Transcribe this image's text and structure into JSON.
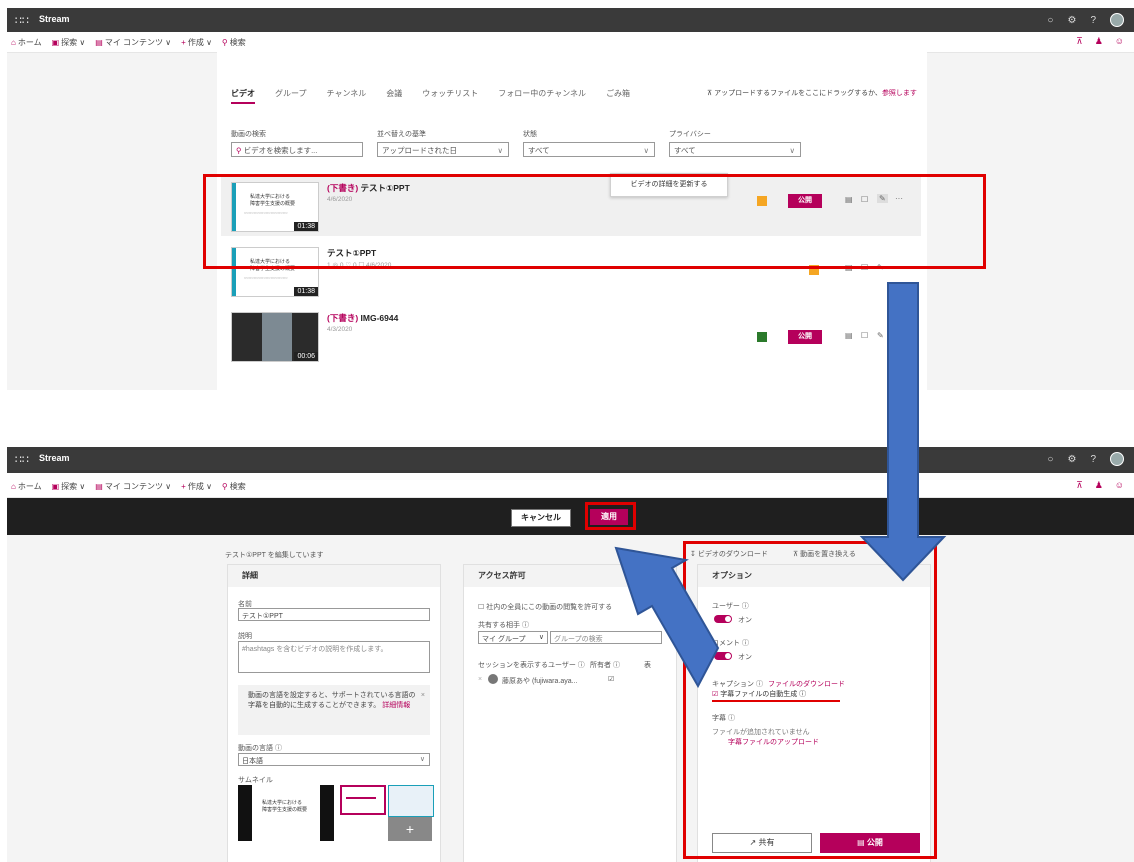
{
  "colors": {
    "brand": "#b5005b",
    "highlight": "#e00000",
    "arrow": "#4472c4",
    "topbar": "#3a3a3a"
  },
  "app": {
    "name": "Stream"
  },
  "nav": {
    "home": "ホーム",
    "browse": "探索",
    "browse_chev": "∨",
    "my_content": "マイ コンテンツ",
    "my_content_chev": "∨",
    "create": "作成",
    "create_chev": "∨",
    "search": "検索"
  },
  "screen1": {
    "tabs": [
      "ビデオ",
      "グループ",
      "チャンネル",
      "会議",
      "ウォッチリスト",
      "フォロー中のチャンネル",
      "ごみ箱"
    ],
    "upload_hint": "アップロードするファイルをここにドラッグするか、",
    "upload_link": "参照します",
    "filters": {
      "search_label": "動画の検索",
      "search_placeholder": "ビデオを検索します...",
      "sort_label": "並べ替えの基準",
      "sort_value": "アップロードされた日",
      "status_label": "状態",
      "status_value": "すべて",
      "privacy_label": "プライバシー",
      "privacy_value": "すべて",
      "chev": "∨"
    },
    "videos": [
      {
        "draft": "(下書き)",
        "title": "テスト①PPT",
        "meta": "4/6/2020",
        "duration": "01:38",
        "publish": "公開",
        "more": "···",
        "thumb_title": "私達大学における\n障害学生支援の概要",
        "thumb_sub": "○○○○○○○○○○○○○○○○○○"
      },
      {
        "draft": "",
        "title": "テスト①PPT",
        "meta": "1 ◎   0 ♡   0 ☐   4/6/2020",
        "duration": "01:38",
        "thumb_title": "私達大学における\n障害学生支援の概要",
        "thumb_sub": "○○○○○○○○○○○○○○○○○○"
      },
      {
        "draft": "(下書き)",
        "title": "IMG-6944",
        "meta": "4/3/2020",
        "duration": "00:06",
        "publish": "公開"
      }
    ],
    "tooltip": "ビデオの詳細を更新する"
  },
  "screen2": {
    "cancel": "キャンセル",
    "apply": "適用",
    "editing_label": "テスト①PPT を編集しています",
    "details": {
      "header": "詳細",
      "name_label": "名前",
      "name_value": "テスト①PPT",
      "desc_label": "説明",
      "desc_placeholder": "#hashtags を含むビデオの説明を作成します。",
      "notice": "動画の言語を設定すると、サポートされている言語の字幕を自動的に生成することができます。",
      "notice_link": "詳細情報",
      "close": "×",
      "lang_label": "動画の言語 ⓘ",
      "lang_value": "日本語",
      "lang_chev": "∨",
      "thumb_label": "サムネイル",
      "add": "+"
    },
    "access": {
      "header": "アクセス許可",
      "allow_all": "社内の全員にこの動画の閲覧を許可する",
      "share_label": "共有する相手 ⓘ",
      "share_type": "マイ グループ",
      "share_chev": "∨",
      "group_search": "グループの検索",
      "session_label": "セッションを表示するユーザー ⓘ",
      "owner_label": "所有者 ⓘ",
      "display_label": "表",
      "user": "藤原あや (fujiwara.aya...",
      "remove": "×"
    },
    "options": {
      "download": "ビデオのダウンロード",
      "replace": "動画を置き換える",
      "header": "オプション",
      "users_label": "ユーザー ⓘ",
      "users_state": "オン",
      "comments_label": "コメント ⓘ",
      "comments_state": "オン",
      "caption_label": "キャプション ⓘ",
      "caption_link": "ファイルのダウンロード",
      "auto_caption": "字幕ファイルの自動生成 ⓘ",
      "subtitle_label": "字幕 ⓘ",
      "no_file": "ファイルが追加されていません",
      "upload_subtitle": "字幕ファイルのアップロード",
      "share": "共有",
      "publish": "公開"
    }
  }
}
